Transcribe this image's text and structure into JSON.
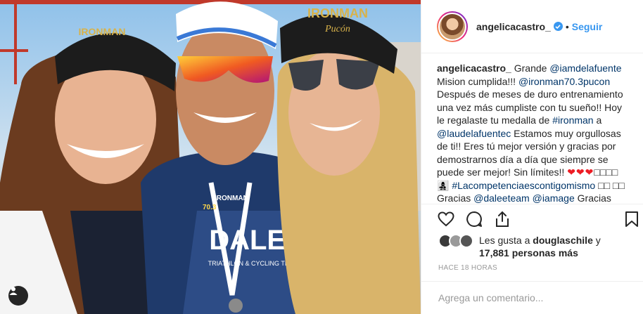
{
  "post": {
    "username": "angelicacastro_",
    "follow_label": "Seguir",
    "separator": "•",
    "photo_cap_texts": [
      "IRONMAN",
      "70.3",
      "Pucón",
      "IRONMAN",
      "Pucón",
      "IRONMAN",
      "70.3"
    ],
    "photo_shirt_text": "DALEE",
    "photo_shirt_sub": "TRIATHLON & CYCLING TEAM",
    "caption": {
      "author": "angelicacastro_",
      "t1": " Grande ",
      "m1": "@iamdelafuente",
      "t2": " Mision cumplida!!! ",
      "m2": "@ironman70.3pucon",
      "t3": " Después de meses de duro entrenamiento una vez más cumpliste con tu sueño!! Hoy le regalaste tu medalla de ",
      "h1": "#ironman",
      "t4": " a ",
      "m3": "@laudelafuentec",
      "t5": " Estamos muy orgullosas de ti!! Eres tú mejor versión y gracias por demostrarnos día a día que siempre se puede ser mejor! Sin límites!! ",
      "hearts": "❤❤❤",
      "t6": "□□□□ 👩‍👧‍👦 ",
      "h2": "#Lacompetenciaescontigomismo",
      "t7": " □□ □□ Gracias ",
      "m4": "@daleeteam",
      "t8": " ",
      "m5": "@iamage",
      "t9": " Gracias"
    },
    "likes": {
      "prefix": "Les gusta a ",
      "user": "douglaschile",
      "mid": " y",
      "count": "17,881 personas más"
    },
    "time": "HACE 18 HORAS",
    "comment_placeholder": "Agrega un comentario...",
    "icons": [
      "heart-icon",
      "comment-icon",
      "share-icon",
      "bookmark-icon",
      "user-tag-icon",
      "verified-badge-icon"
    ],
    "colors": {
      "link": "#003569",
      "follow": "#3897f0",
      "meta": "#999999",
      "border": "#efefef"
    }
  }
}
